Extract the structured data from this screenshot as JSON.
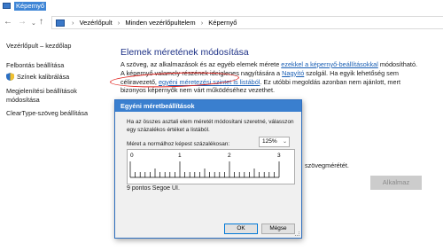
{
  "window": {
    "title": "Képernyő"
  },
  "nav": {
    "back": "←",
    "forward": "→",
    "recent": "⌄",
    "up": "↑",
    "breadcrumbs": [
      "Vezérlőpult",
      "Minden vezérlőpultelem",
      "Képernyő"
    ],
    "separator": "›"
  },
  "sidebar": {
    "items": [
      {
        "label": "Vezérlőpult – kezdőlap"
      },
      {
        "label": "Felbontás beállítása"
      },
      {
        "label": "Színek kalibrálása"
      },
      {
        "label": "Megjelenítési beállítások\nmódosítása"
      },
      {
        "label": "ClearType-szöveg beállítása"
      }
    ]
  },
  "main": {
    "heading": "Elemek méretének módosítása",
    "p1": "A szöveg, az alkalmazások és az egyéb elemek mérete ",
    "link1": "ezekkel a képernyő-beállításokkal",
    "p2": " módosítható. A képernyő valamely részének ideiglenes nagyítására a ",
    "link2": "Nagyító",
    "p3": " szolgál. Ha egyik lehetőség sem céliravezető, ",
    "link3": "egyéni méretezési szintet is listából",
    "p4": ". Ez utóbbi megoldás azonban nem ajánlott, mert bizonyos képernyők nem várt működéséhez vezethet.",
    "bg_tail": "szövegmérétét.",
    "apply_label": "Alkalmaz"
  },
  "dialog": {
    "title": "Egyéni méretbeállítások",
    "description": "Ha az összes asztali elem méretét módosítani szeretné, válasszon egy százalékos értéket a listából.",
    "scale_label": "Méret a normálhoz képest százalékosan:",
    "scale_value": "125%",
    "ruler_labels": [
      "0",
      "1",
      "2",
      "3"
    ],
    "sample_text": "9 pontos Segoe UI.",
    "ok_label": "OK",
    "cancel_label": "Mégse"
  },
  "colors": {
    "accent": "#3a7fcf",
    "link": "#1a5fb4",
    "heading": "#1e3287",
    "annotation": "#e0241f"
  }
}
